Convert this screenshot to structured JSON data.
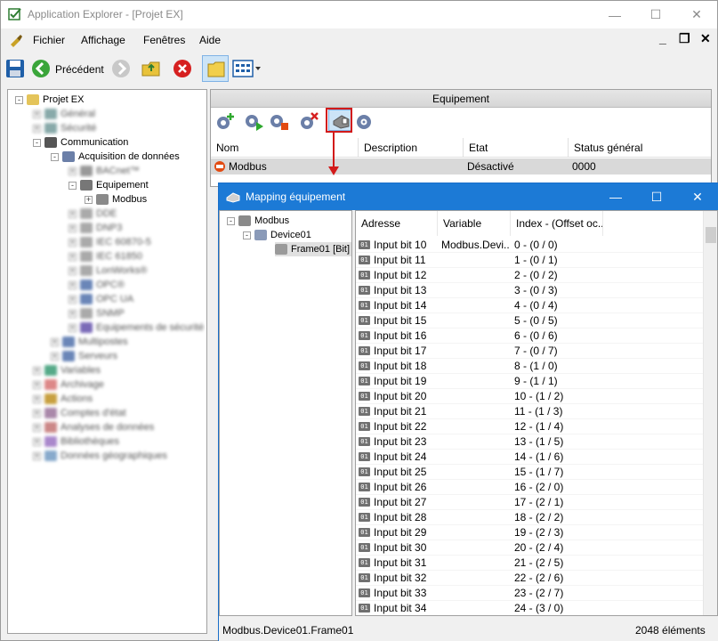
{
  "window": {
    "title": "Application Explorer - [Projet EX]",
    "controls": [
      "minimize-icon",
      "maximize-icon",
      "close-icon"
    ]
  },
  "menu": {
    "items": [
      "Fichier",
      "Affichage",
      "Fenêtres",
      "Aide"
    ],
    "mdi_controls": [
      "_",
      "❐",
      "✕"
    ]
  },
  "toolbar": {
    "back_label": "Précédent",
    "icons": [
      "save-icon",
      "back-icon",
      "forward-icon",
      "folder-up-icon",
      "stop-icon",
      "folders-icon",
      "view-icon"
    ]
  },
  "tree": {
    "root": "Projet EX",
    "communication": "Communication",
    "acquisition": "Acquisition de données",
    "equipement": "Equipement",
    "modbus": "Modbus"
  },
  "panel": {
    "header": "Equipement",
    "columns": [
      "Nom",
      "Description",
      "Etat",
      "Status général"
    ],
    "row": {
      "name": "Modbus",
      "description": "",
      "state": "Désactivé",
      "status": "0000"
    }
  },
  "dialog": {
    "title": "Mapping équipement",
    "tree": {
      "root": "Modbus",
      "device": "Device01",
      "frame": "Frame01 [Bit]"
    },
    "columns": [
      "Adresse",
      "Variable",
      "Index - (Offset oc..."
    ],
    "rows": [
      {
        "address": "Input bit 10",
        "variable": "Modbus.Devi...",
        "index": "0 - (0 / 0)"
      },
      {
        "address": "Input bit 11",
        "variable": "",
        "index": "1 - (0 / 1)"
      },
      {
        "address": "Input bit 12",
        "variable": "",
        "index": "2 - (0 / 2)"
      },
      {
        "address": "Input bit 13",
        "variable": "",
        "index": "3 - (0 / 3)"
      },
      {
        "address": "Input bit 14",
        "variable": "",
        "index": "4 - (0 / 4)"
      },
      {
        "address": "Input bit 15",
        "variable": "",
        "index": "5 - (0 / 5)"
      },
      {
        "address": "Input bit 16",
        "variable": "",
        "index": "6 - (0 / 6)"
      },
      {
        "address": "Input bit 17",
        "variable": "",
        "index": "7 - (0 / 7)"
      },
      {
        "address": "Input bit 18",
        "variable": "",
        "index": "8 - (1 / 0)"
      },
      {
        "address": "Input bit 19",
        "variable": "",
        "index": "9 - (1 / 1)"
      },
      {
        "address": "Input bit 20",
        "variable": "",
        "index": "10 - (1 / 2)"
      },
      {
        "address": "Input bit 21",
        "variable": "",
        "index": "11 - (1 / 3)"
      },
      {
        "address": "Input bit 22",
        "variable": "",
        "index": "12 - (1 / 4)"
      },
      {
        "address": "Input bit 23",
        "variable": "",
        "index": "13 - (1 / 5)"
      },
      {
        "address": "Input bit 24",
        "variable": "",
        "index": "14 - (1 / 6)"
      },
      {
        "address": "Input bit 25",
        "variable": "",
        "index": "15 - (1 / 7)"
      },
      {
        "address": "Input bit 26",
        "variable": "",
        "index": "16 - (2 / 0)"
      },
      {
        "address": "Input bit 27",
        "variable": "",
        "index": "17 - (2 / 1)"
      },
      {
        "address": "Input bit 28",
        "variable": "",
        "index": "18 - (2 / 2)"
      },
      {
        "address": "Input bit 29",
        "variable": "",
        "index": "19 - (2 / 3)"
      },
      {
        "address": "Input bit 30",
        "variable": "",
        "index": "20 - (2 / 4)"
      },
      {
        "address": "Input bit 31",
        "variable": "",
        "index": "21 - (2 / 5)"
      },
      {
        "address": "Input bit 32",
        "variable": "",
        "index": "22 - (2 / 6)"
      },
      {
        "address": "Input bit 33",
        "variable": "",
        "index": "23 - (2 / 7)"
      },
      {
        "address": "Input bit 34",
        "variable": "",
        "index": "24 - (3 / 0)"
      }
    ],
    "status_path": "Modbus.Device01.Frame01",
    "status_count": "2048 éléments"
  },
  "colors": {
    "accent": "#1c7ad6",
    "highlight": "#d21a1a",
    "selection": "#d9d9d9"
  }
}
